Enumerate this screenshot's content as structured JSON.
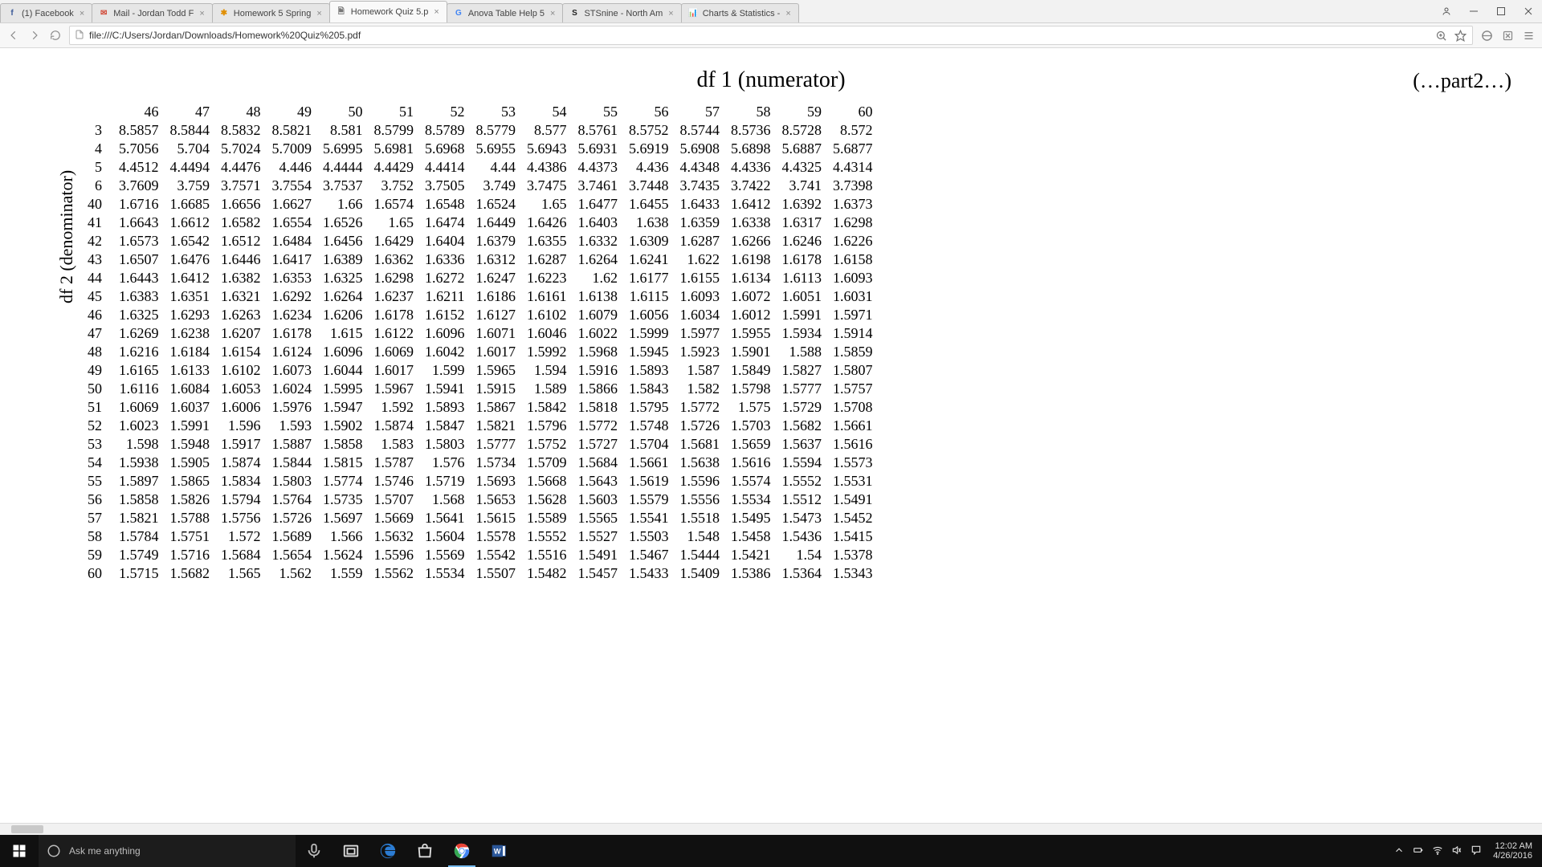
{
  "browser": {
    "tabs": [
      {
        "favicon": "f",
        "fav_color": "#3b5998",
        "label": "(1) Facebook"
      },
      {
        "favicon": "✉",
        "fav_color": "#d14836",
        "label": "Mail - Jordan Todd F"
      },
      {
        "favicon": "✱",
        "fav_color": "#e08e00",
        "label": "Homework 5 Spring"
      },
      {
        "favicon": "🗎",
        "fav_color": "#777",
        "label": "Homework Quiz 5.p"
      },
      {
        "favicon": "G",
        "fav_color": "#4285f4",
        "label": "Anova Table Help 5"
      },
      {
        "favicon": "S",
        "fav_color": "#222",
        "label": "STSnine - North Am"
      },
      {
        "favicon": "📊",
        "fav_color": "#cc7a00",
        "label": "Charts & Statistics -"
      }
    ],
    "active_tab": 3,
    "url": "file:///C:/Users/Jordan/Downloads/Homework%20Quiz%205.pdf"
  },
  "doc": {
    "title": "df 1 (numerator)",
    "part_label": "(…part2…)",
    "y_axis_label": "df 2 (denominator)",
    "col_headers": [
      "46",
      "47",
      "48",
      "49",
      "50",
      "51",
      "52",
      "53",
      "54",
      "55",
      "56",
      "57",
      "58",
      "59",
      "60"
    ],
    "row_headers": [
      "3",
      "4",
      "5",
      "6",
      "40",
      "41",
      "42",
      "43",
      "44",
      "45",
      "46",
      "47",
      "48",
      "49",
      "50",
      "51",
      "52",
      "53",
      "54",
      "55",
      "56",
      "57",
      "58",
      "59",
      "60"
    ],
    "rows": [
      [
        "8.5857",
        "8.5844",
        "8.5832",
        "8.5821",
        "8.581",
        "8.5799",
        "8.5789",
        "8.5779",
        "8.577",
        "8.5761",
        "8.5752",
        "8.5744",
        "8.5736",
        "8.5728",
        "8.572"
      ],
      [
        "5.7056",
        "5.704",
        "5.7024",
        "5.7009",
        "5.6995",
        "5.6981",
        "5.6968",
        "5.6955",
        "5.6943",
        "5.6931",
        "5.6919",
        "5.6908",
        "5.6898",
        "5.6887",
        "5.6877"
      ],
      [
        "4.4512",
        "4.4494",
        "4.4476",
        "4.446",
        "4.4444",
        "4.4429",
        "4.4414",
        "4.44",
        "4.4386",
        "4.4373",
        "4.436",
        "4.4348",
        "4.4336",
        "4.4325",
        "4.4314"
      ],
      [
        "3.7609",
        "3.759",
        "3.7571",
        "3.7554",
        "3.7537",
        "3.752",
        "3.7505",
        "3.749",
        "3.7475",
        "3.7461",
        "3.7448",
        "3.7435",
        "3.7422",
        "3.741",
        "3.7398"
      ],
      [
        "1.6716",
        "1.6685",
        "1.6656",
        "1.6627",
        "1.66",
        "1.6574",
        "1.6548",
        "1.6524",
        "1.65",
        "1.6477",
        "1.6455",
        "1.6433",
        "1.6412",
        "1.6392",
        "1.6373"
      ],
      [
        "1.6643",
        "1.6612",
        "1.6582",
        "1.6554",
        "1.6526",
        "1.65",
        "1.6474",
        "1.6449",
        "1.6426",
        "1.6403",
        "1.638",
        "1.6359",
        "1.6338",
        "1.6317",
        "1.6298"
      ],
      [
        "1.6573",
        "1.6542",
        "1.6512",
        "1.6484",
        "1.6456",
        "1.6429",
        "1.6404",
        "1.6379",
        "1.6355",
        "1.6332",
        "1.6309",
        "1.6287",
        "1.6266",
        "1.6246",
        "1.6226"
      ],
      [
        "1.6507",
        "1.6476",
        "1.6446",
        "1.6417",
        "1.6389",
        "1.6362",
        "1.6336",
        "1.6312",
        "1.6287",
        "1.6264",
        "1.6241",
        "1.622",
        "1.6198",
        "1.6178",
        "1.6158"
      ],
      [
        "1.6443",
        "1.6412",
        "1.6382",
        "1.6353",
        "1.6325",
        "1.6298",
        "1.6272",
        "1.6247",
        "1.6223",
        "1.62",
        "1.6177",
        "1.6155",
        "1.6134",
        "1.6113",
        "1.6093"
      ],
      [
        "1.6383",
        "1.6351",
        "1.6321",
        "1.6292",
        "1.6264",
        "1.6237",
        "1.6211",
        "1.6186",
        "1.6161",
        "1.6138",
        "1.6115",
        "1.6093",
        "1.6072",
        "1.6051",
        "1.6031"
      ],
      [
        "1.6325",
        "1.6293",
        "1.6263",
        "1.6234",
        "1.6206",
        "1.6178",
        "1.6152",
        "1.6127",
        "1.6102",
        "1.6079",
        "1.6056",
        "1.6034",
        "1.6012",
        "1.5991",
        "1.5971"
      ],
      [
        "1.6269",
        "1.6238",
        "1.6207",
        "1.6178",
        "1.615",
        "1.6122",
        "1.6096",
        "1.6071",
        "1.6046",
        "1.6022",
        "1.5999",
        "1.5977",
        "1.5955",
        "1.5934",
        "1.5914"
      ],
      [
        "1.6216",
        "1.6184",
        "1.6154",
        "1.6124",
        "1.6096",
        "1.6069",
        "1.6042",
        "1.6017",
        "1.5992",
        "1.5968",
        "1.5945",
        "1.5923",
        "1.5901",
        "1.588",
        "1.5859"
      ],
      [
        "1.6165",
        "1.6133",
        "1.6102",
        "1.6073",
        "1.6044",
        "1.6017",
        "1.599",
        "1.5965",
        "1.594",
        "1.5916",
        "1.5893",
        "1.587",
        "1.5849",
        "1.5827",
        "1.5807"
      ],
      [
        "1.6116",
        "1.6084",
        "1.6053",
        "1.6024",
        "1.5995",
        "1.5967",
        "1.5941",
        "1.5915",
        "1.589",
        "1.5866",
        "1.5843",
        "1.582",
        "1.5798",
        "1.5777",
        "1.5757"
      ],
      [
        "1.6069",
        "1.6037",
        "1.6006",
        "1.5976",
        "1.5947",
        "1.592",
        "1.5893",
        "1.5867",
        "1.5842",
        "1.5818",
        "1.5795",
        "1.5772",
        "1.575",
        "1.5729",
        "1.5708"
      ],
      [
        "1.6023",
        "1.5991",
        "1.596",
        "1.593",
        "1.5902",
        "1.5874",
        "1.5847",
        "1.5821",
        "1.5796",
        "1.5772",
        "1.5748",
        "1.5726",
        "1.5703",
        "1.5682",
        "1.5661"
      ],
      [
        "1.598",
        "1.5948",
        "1.5917",
        "1.5887",
        "1.5858",
        "1.583",
        "1.5803",
        "1.5777",
        "1.5752",
        "1.5727",
        "1.5704",
        "1.5681",
        "1.5659",
        "1.5637",
        "1.5616"
      ],
      [
        "1.5938",
        "1.5905",
        "1.5874",
        "1.5844",
        "1.5815",
        "1.5787",
        "1.576",
        "1.5734",
        "1.5709",
        "1.5684",
        "1.5661",
        "1.5638",
        "1.5616",
        "1.5594",
        "1.5573"
      ],
      [
        "1.5897",
        "1.5865",
        "1.5834",
        "1.5803",
        "1.5774",
        "1.5746",
        "1.5719",
        "1.5693",
        "1.5668",
        "1.5643",
        "1.5619",
        "1.5596",
        "1.5574",
        "1.5552",
        "1.5531"
      ],
      [
        "1.5858",
        "1.5826",
        "1.5794",
        "1.5764",
        "1.5735",
        "1.5707",
        "1.568",
        "1.5653",
        "1.5628",
        "1.5603",
        "1.5579",
        "1.5556",
        "1.5534",
        "1.5512",
        "1.5491"
      ],
      [
        "1.5821",
        "1.5788",
        "1.5756",
        "1.5726",
        "1.5697",
        "1.5669",
        "1.5641",
        "1.5615",
        "1.5589",
        "1.5565",
        "1.5541",
        "1.5518",
        "1.5495",
        "1.5473",
        "1.5452"
      ],
      [
        "1.5784",
        "1.5751",
        "1.572",
        "1.5689",
        "1.566",
        "1.5632",
        "1.5604",
        "1.5578",
        "1.5552",
        "1.5527",
        "1.5503",
        "1.548",
        "1.5458",
        "1.5436",
        "1.5415"
      ],
      [
        "1.5749",
        "1.5716",
        "1.5684",
        "1.5654",
        "1.5624",
        "1.5596",
        "1.5569",
        "1.5542",
        "1.5516",
        "1.5491",
        "1.5467",
        "1.5444",
        "1.5421",
        "1.54",
        "1.5378"
      ],
      [
        "1.5715",
        "1.5682",
        "1.565",
        "1.562",
        "1.559",
        "1.5562",
        "1.5534",
        "1.5507",
        "1.5482",
        "1.5457",
        "1.5433",
        "1.5409",
        "1.5386",
        "1.5364",
        "1.5343"
      ]
    ]
  },
  "taskbar": {
    "search_placeholder": "Ask me anything",
    "time": "12:02 AM",
    "date": "4/26/2016"
  }
}
